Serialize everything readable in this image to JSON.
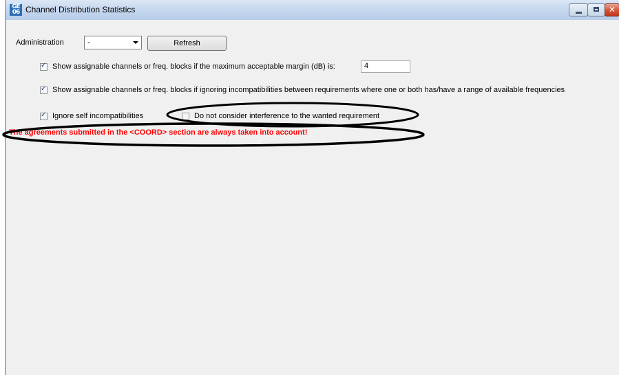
{
  "window": {
    "title": "Channel Distribution Statistics",
    "icon_label_top": "GE",
    "icon_label_bottom": "06"
  },
  "toolbar": {
    "administration_label": "Administration",
    "administration_value": "-",
    "refresh_label": "Refresh"
  },
  "options": {
    "max_margin": {
      "label": "Show assignable channels or freq. blocks if the maximum acceptable margin (dB) is:",
      "checked": true,
      "value": "4"
    },
    "ignore_range": {
      "label": "Show assignable channels or freq. blocks if ignoring incompatibilities between requirements where one or both has/have a range of available frequencies",
      "checked": true
    },
    "ignore_self": {
      "label": "Ignore self incompatibilities",
      "checked": true
    },
    "no_interference": {
      "label": "Do not consider interference to the wanted requirement",
      "checked": false
    }
  },
  "warning": "The agreements submitted in the <COORD> section are always taken into account!",
  "colors": {
    "warning": "#ff0000",
    "annotation": "#000000",
    "background": "#f0f0f0"
  }
}
